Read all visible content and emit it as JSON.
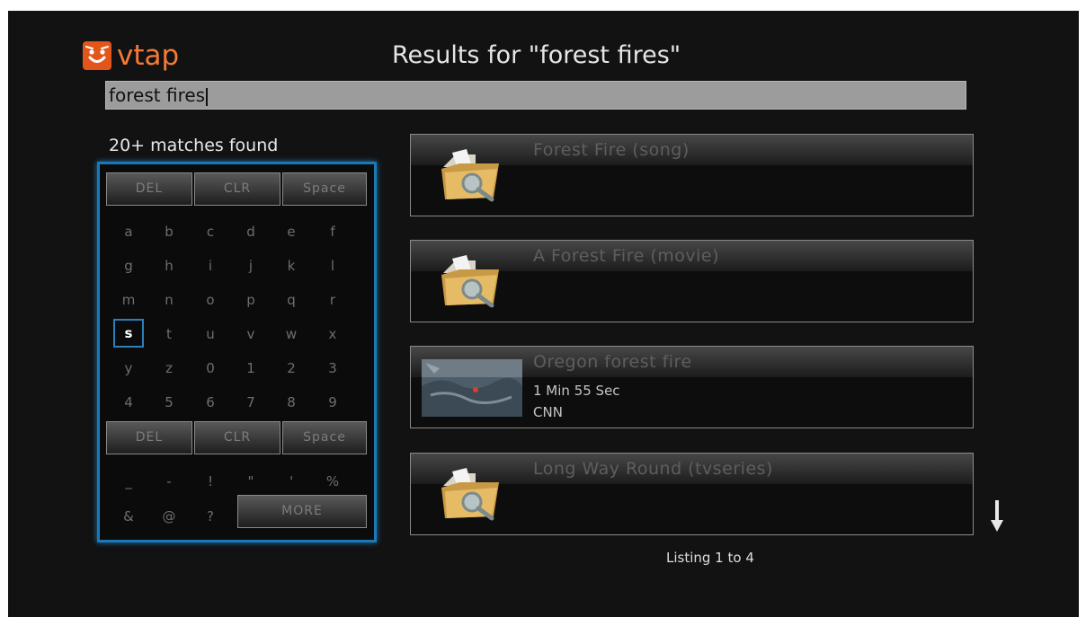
{
  "app": {
    "logo_text": "vtap",
    "logo_icon": "smiley-face-icon",
    "accent": "#e2561b"
  },
  "header": {
    "title": "Results for \"forest fires\""
  },
  "search": {
    "value": "forest fires"
  },
  "matches_label": "20+ matches found",
  "keyboard": {
    "top_row": [
      "DEL",
      "CLR",
      "Space"
    ],
    "letter_rows": [
      [
        "a",
        "b",
        "c",
        "d",
        "e",
        "f"
      ],
      [
        "g",
        "h",
        "i",
        "j",
        "k",
        "l"
      ],
      [
        "m",
        "n",
        "o",
        "p",
        "q",
        "r"
      ],
      [
        "s",
        "t",
        "u",
        "v",
        "w",
        "x"
      ],
      [
        "y",
        "z",
        "0",
        "1",
        "2",
        "3"
      ],
      [
        "4",
        "5",
        "6",
        "7",
        "8",
        "9"
      ]
    ],
    "middle_row": [
      "DEL",
      "CLR",
      "Space"
    ],
    "symbol_row": [
      "_",
      "-",
      "!",
      "\"",
      "'",
      "%"
    ],
    "last_row": [
      "&",
      "@",
      "?"
    ],
    "more_label": "MORE",
    "selected_key": "s",
    "highlight_color": "#1c78b4"
  },
  "results": [
    {
      "title": "Forest Fire (song)",
      "icon": "folder-search-icon"
    },
    {
      "title": "A Forest Fire (movie)",
      "icon": "folder-search-icon"
    },
    {
      "title": "Oregon forest fire",
      "icon": "video-thumbnail",
      "duration": "1 Min 55 Sec",
      "source": "CNN"
    },
    {
      "title": "Long Way Round (tvseries)",
      "icon": "folder-search-icon"
    }
  ],
  "scroll": {
    "icon": "arrow-down-icon"
  },
  "listing": "Listing 1 to 4"
}
